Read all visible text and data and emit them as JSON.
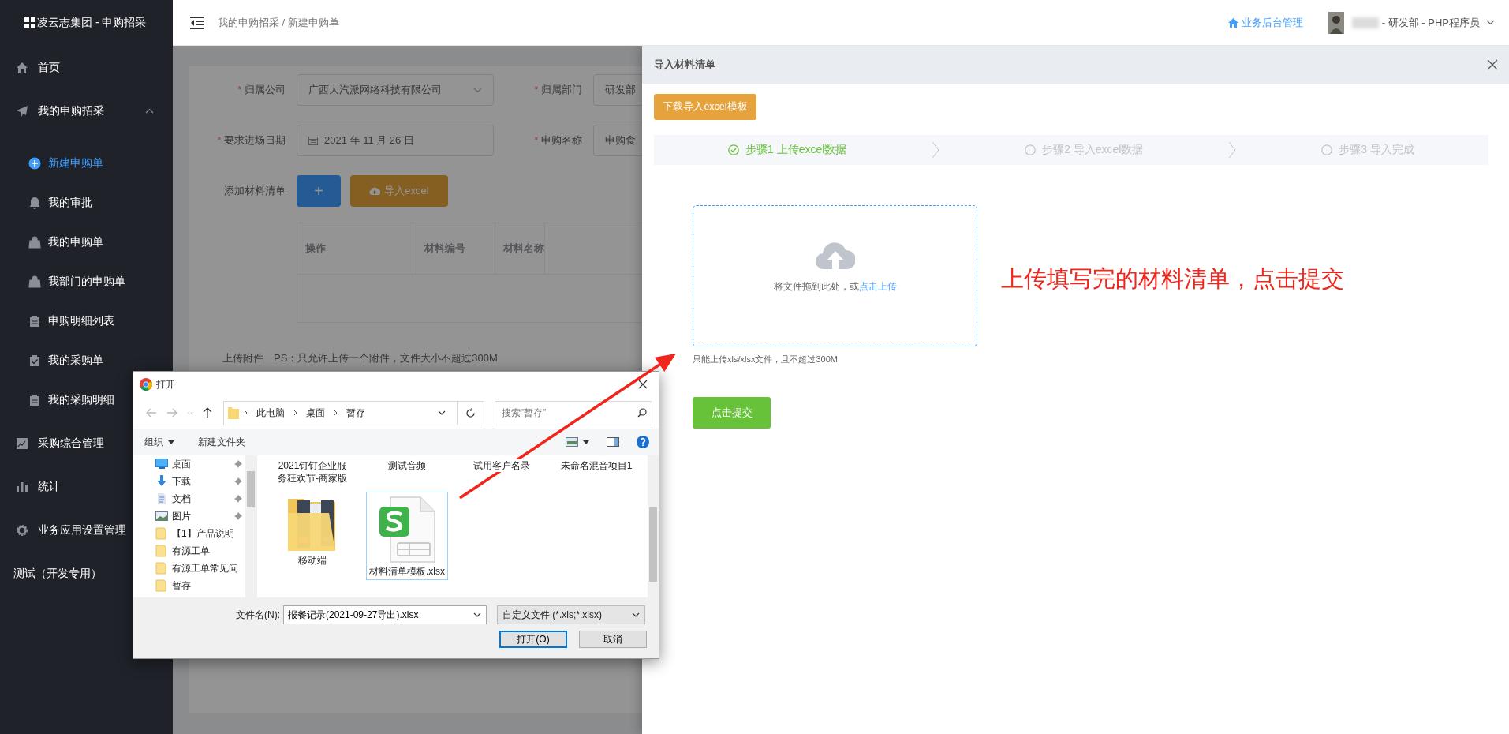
{
  "sidebar": {
    "title": "凌云志集团 - 申购招采",
    "items": [
      {
        "label": "首页",
        "selected": false
      },
      {
        "label": "我的申购招采",
        "selected": false,
        "expanded": true,
        "children": [
          {
            "label": "新建申购单",
            "selected": true
          },
          {
            "label": "我的审批",
            "selected": false
          },
          {
            "label": "我的申购单",
            "selected": false
          },
          {
            "label": "我部门的申购单",
            "selected": false
          },
          {
            "label": "申购明细列表",
            "selected": false
          },
          {
            "label": "我的采购单",
            "selected": false
          },
          {
            "label": "我的采购明细",
            "selected": false
          }
        ]
      },
      {
        "label": "采购综合管理",
        "selected": false
      },
      {
        "label": "统计",
        "selected": false
      },
      {
        "label": "业务应用设置管理",
        "selected": false
      },
      {
        "label": "测试（开发专用）",
        "selected": false
      }
    ]
  },
  "header": {
    "breadcrumb": "我的申购招采 / 新建申购单",
    "admin_link": "业务后台管理",
    "user": "- 研发部 - PHP程序员"
  },
  "form": {
    "rows": [
      [
        {
          "mark": "*",
          "label": "归属公司",
          "value": "广西大汽派网络科技有限公司",
          "kind": "select"
        },
        {
          "mark": "*",
          "label": "归属部门",
          "value": "研发部",
          "kind": "text"
        }
      ],
      [
        {
          "mark": "*",
          "label": "要求进场日期",
          "value": "2021 年 11 月 26 日",
          "kind": "date"
        },
        {
          "mark": "*",
          "label": "申购名称",
          "value": "申购食",
          "kind": "text"
        }
      ]
    ],
    "materials": {
      "label": "添加材料清单",
      "add_button": "+",
      "import_button": "导入excel",
      "columns": [
        "操作",
        "材料编号",
        "材料名称"
      ]
    },
    "attachment": {
      "label": "上传附件",
      "note": "PS：只允许上传一个附件，文件大小不超过300M"
    }
  },
  "drawer": {
    "title": "导入材料清单",
    "download_button": "下载导入excel模板",
    "steps": [
      {
        "label": "步骤1 上传excel数据",
        "done": true
      },
      {
        "label": "步骤2 导入excel数据",
        "done": false
      },
      {
        "label": "步骤3 导入完成",
        "done": false
      }
    ],
    "upload": {
      "text": "将文件拖到此处，或",
      "link": "点击上传",
      "hint": "只能上传xls/xlsx文件，且不超过300M"
    },
    "annotation": "上传填写完的材料清单，点击提交",
    "submit_button": "点击提交"
  },
  "file_dialog": {
    "title": "打开",
    "path": [
      "此电脑",
      "桌面",
      "暂存"
    ],
    "search_placeholder": "搜索\"暂存\"",
    "toolbar": {
      "organize": "组织",
      "new_folder": "新建文件夹"
    },
    "nav_items": [
      {
        "label": "桌面",
        "kind": "desktop",
        "pinned": true
      },
      {
        "label": "下载",
        "kind": "download",
        "pinned": true
      },
      {
        "label": "文档",
        "kind": "document",
        "pinned": true
      },
      {
        "label": "图片",
        "kind": "pictures",
        "pinned": true
      },
      {
        "label": "【1】产品说明",
        "kind": "folder",
        "pinned": false
      },
      {
        "label": "有源工单",
        "kind": "folder",
        "pinned": false
      },
      {
        "label": "有源工单常见问",
        "kind": "folder",
        "pinned": false
      },
      {
        "label": "暂存",
        "kind": "folder",
        "pinned": false
      }
    ],
    "files": [
      {
        "name": "2021钉钉企业服务狂欢节-商家版",
        "kind": "scrolled",
        "selected": false
      },
      {
        "name": "测试音频",
        "kind": "scrolled",
        "selected": false
      },
      {
        "name": "试用客户名录",
        "kind": "scrolled",
        "selected": false
      },
      {
        "name": "未命名混音项目1",
        "kind": "scrolled",
        "selected": false
      },
      {
        "name": "移动端",
        "kind": "folder",
        "selected": false
      },
      {
        "name": "材料清单模板.xlsx",
        "kind": "spreadsheet",
        "selected": true
      }
    ],
    "filename_label": "文件名(N):",
    "filename": "报餐记录(2021-09-27导出).xlsx",
    "filetype": "自定义文件 (*.xls;*.xlsx)",
    "open_button": "打开(O)",
    "cancel_button": "取消"
  }
}
